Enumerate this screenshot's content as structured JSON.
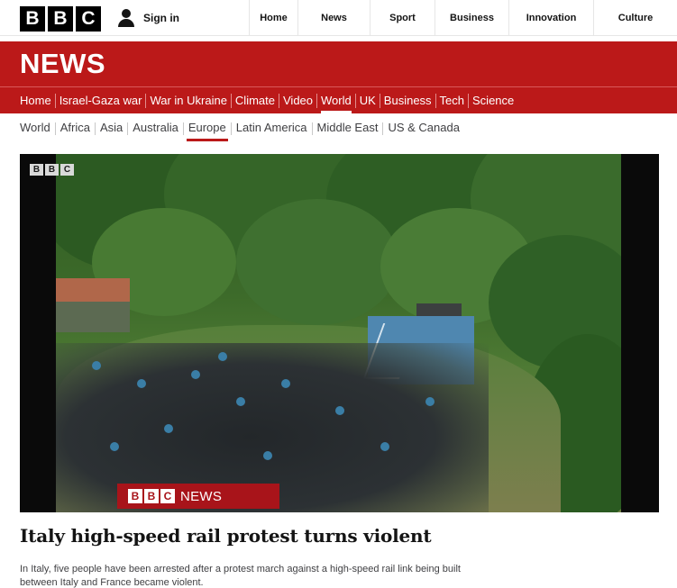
{
  "brand": {
    "logo_letters": [
      "B",
      "B",
      "C"
    ]
  },
  "account": {
    "signin_label": "Sign in",
    "icon": "user-icon"
  },
  "top_nav": [
    "Home",
    "News",
    "Sport",
    "Business",
    "Innovation",
    "Culture"
  ],
  "news": {
    "title": "NEWS",
    "brand_color": "#bb1919",
    "nav": [
      "Home",
      "Israel-Gaza war",
      "War in Ukraine",
      "Climate",
      "Video",
      "World",
      "UK",
      "Business",
      "Tech",
      "Science"
    ],
    "nav_active": "World"
  },
  "sub_nav": {
    "items": [
      "World",
      "Africa",
      "Asia",
      "Australia",
      "Europe",
      "Latin America",
      "Middle East",
      "US & Canada"
    ],
    "active": "Europe"
  },
  "video": {
    "watermark_letters": [
      "B",
      "B",
      "C"
    ],
    "lower_third_letters": [
      "B",
      "B",
      "C"
    ],
    "lower_third_word": "NEWS"
  },
  "article": {
    "headline": "Italy high-speed rail protest turns violent",
    "summary": "In Italy, five people have been arrested after a protest march against a high-speed rail link being built between Italy and France became violent."
  }
}
